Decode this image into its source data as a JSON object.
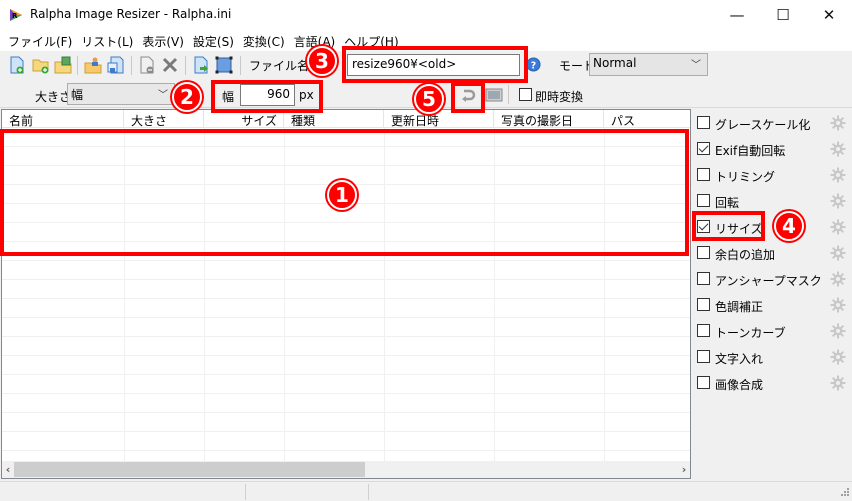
{
  "window": {
    "title": "Ralpha Image Resizer - Ralpha.ini",
    "controls": {
      "minimize": "—",
      "maximize": "☐",
      "close": "✕"
    }
  },
  "menu": [
    {
      "label": "ファイル(F)"
    },
    {
      "label": "リスト(L)"
    },
    {
      "label": "表示(V)"
    },
    {
      "label": "設定(S)"
    },
    {
      "label": "変換(C)"
    },
    {
      "label": "言語(A)"
    },
    {
      "label": "ヘルプ(H)"
    }
  ],
  "toolbar": {
    "icons": [
      "add-file-icon",
      "add-folder-icon",
      "add-image-folder-icon",
      "open-folder-user-icon",
      "save-list-icon",
      "remove-file-icon",
      "delete-icon",
      "convert-icon",
      "select-area-icon"
    ],
    "filename_label": "ファイル名生成",
    "filename_value": "resize960¥<old>",
    "help_icon": "help-icon",
    "mode_label": "モード",
    "mode_value": "Normal"
  },
  "toolbar2": {
    "size_label": "大きさ",
    "size_value": "幅",
    "width_label": "幅",
    "width_value": "960",
    "width_unit": "px",
    "instant_convert_label": "即時変換",
    "instant_convert_checked": false
  },
  "list": {
    "columns": [
      {
        "label": "名前"
      },
      {
        "label": "大きさ"
      },
      {
        "label": "サイズ"
      },
      {
        "label": "種類"
      },
      {
        "label": "更新日時"
      },
      {
        "label": "写真の撮影日"
      },
      {
        "label": "パス"
      }
    ],
    "rows": []
  },
  "effects": [
    {
      "label": "グレースケール化",
      "checked": false
    },
    {
      "label": "Exif自動回転",
      "checked": true
    },
    {
      "label": "トリミング",
      "checked": false
    },
    {
      "label": "回転",
      "checked": false
    },
    {
      "label": "リサイズ",
      "checked": true
    },
    {
      "label": "余白の追加",
      "checked": false
    },
    {
      "label": "アンシャープマスク",
      "checked": false
    },
    {
      "label": "色調補正",
      "checked": false
    },
    {
      "label": "トーンカーブ",
      "checked": false
    },
    {
      "label": "文字入れ",
      "checked": false
    },
    {
      "label": "画像合成",
      "checked": false
    }
  ],
  "annotations": [
    {
      "number": "1"
    },
    {
      "number": "2"
    },
    {
      "number": "3"
    },
    {
      "number": "4"
    },
    {
      "number": "5"
    }
  ],
  "colors": {
    "annotation": "#ff0000",
    "window_bg": "#f0f0f0"
  }
}
